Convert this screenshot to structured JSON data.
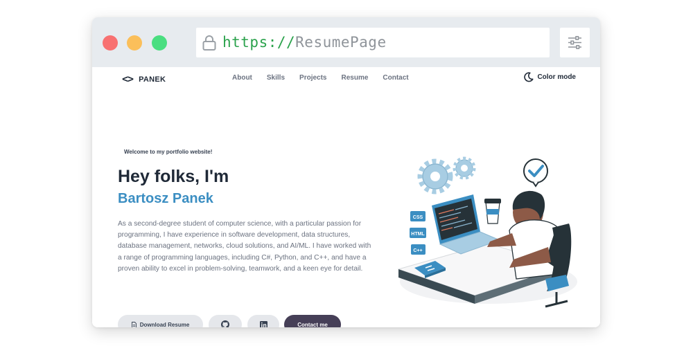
{
  "browser": {
    "url_protocol": "https://",
    "url_host": "ResumePage"
  },
  "header": {
    "logo_mark": "<>",
    "logo_text": "PANEK",
    "nav": [
      "About",
      "Skills",
      "Projects",
      "Resume",
      "Contact"
    ],
    "color_mode_label": "Color mode"
  },
  "hero": {
    "welcome": "Welcome to my portfolio website!",
    "greeting": "Hey folks, I'm",
    "name": "Bartosz Panek",
    "bio": "As a second-degree student of computer science, with a particular passion for programming, I have experience in software development, data structures, database management, networks, cloud solutions, and AI/ML. I have worked with a range of programming languages, including C#, Python, and C++, and have a proven ability to excel in problem-solving, teamwork, and a keen eye for detail.",
    "download_resume_label": "Download Resume",
    "contact_label": "Contact me"
  },
  "illustration": {
    "labels": [
      "CSS",
      "HTML",
      "C++"
    ]
  },
  "colors": {
    "accent": "#3b8ec2",
    "contact_button": "#463f57",
    "chrome": "#e7ebef",
    "url_protocol": "#2ba24c"
  }
}
